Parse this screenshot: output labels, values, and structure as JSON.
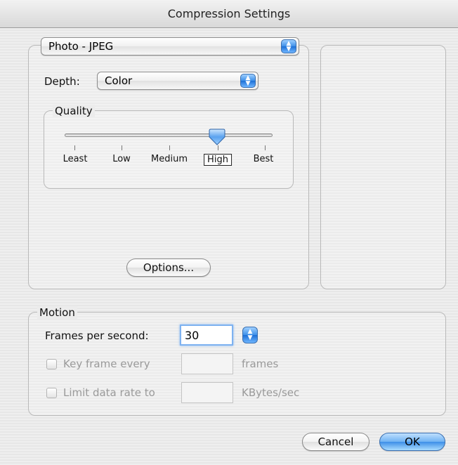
{
  "window": {
    "title": "Compression Settings"
  },
  "compressor": {
    "selected": "Photo - JPEG",
    "depth_label": "Depth:",
    "depth_value": "Color",
    "quality": {
      "label": "Quality",
      "ticks": [
        "Least",
        "Low",
        "Medium",
        "High",
        "Best"
      ],
      "selected": "High",
      "level": 0.75
    },
    "options_button": "Options..."
  },
  "motion": {
    "label": "Motion",
    "fps_label": "Frames per second:",
    "fps_value": "30",
    "key_frame_label": "Key frame every",
    "key_frame_value": "",
    "key_frame_unit": "frames",
    "limit_label": "Limit data rate to",
    "limit_value": "",
    "limit_unit": "KBytes/sec"
  },
  "buttons": {
    "cancel": "Cancel",
    "ok": "OK"
  },
  "icons": {
    "popup_arrows": "popup-arrows-icon",
    "stepper": "stepper-icon"
  }
}
